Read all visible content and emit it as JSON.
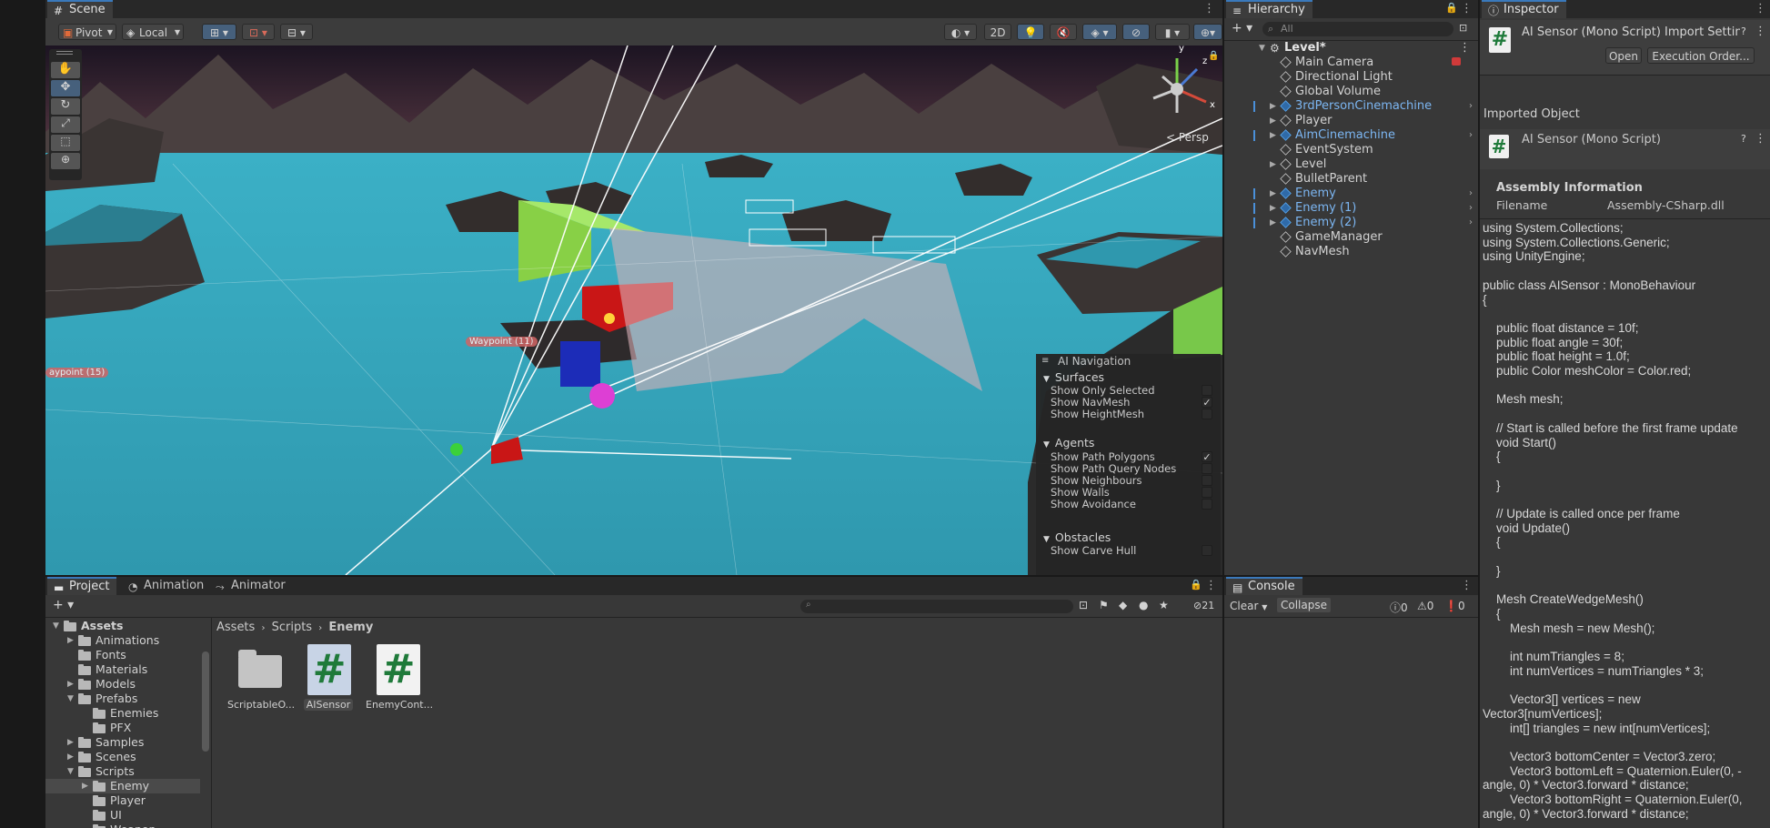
{
  "scene": {
    "tab_label": "Scene",
    "toolbar": {
      "pivot_label": "Pivot",
      "local_label": "Local",
      "mode_2d_label": "2D"
    },
    "gizmo": {
      "persp_label": "< Persp",
      "x": "x",
      "y": "y",
      "z": "z"
    },
    "labels": {
      "waypoint_left": "aypoint (15)",
      "waypoint_center": "Waypoint (11)"
    },
    "ai_navigation": {
      "title": "AI Navigation",
      "surfaces": {
        "header": "Surfaces",
        "items": [
          {
            "label": "Show Only Selected",
            "checked": false
          },
          {
            "label": "Show NavMesh",
            "checked": true
          },
          {
            "label": "Show HeightMesh",
            "checked": false
          }
        ]
      },
      "agents": {
        "header": "Agents",
        "items": [
          {
            "label": "Show Path Polygons",
            "checked": true
          },
          {
            "label": "Show Path Query Nodes",
            "checked": false
          },
          {
            "label": "Show Neighbours",
            "checked": false
          },
          {
            "label": "Show Walls",
            "checked": false
          },
          {
            "label": "Show Avoidance",
            "checked": false
          }
        ]
      },
      "obstacles": {
        "header": "Obstacles",
        "items": [
          {
            "label": "Show Carve Hull",
            "checked": false
          }
        ]
      }
    },
    "colors": {
      "water": "#3fa8bf",
      "green_block": "#8bd44a",
      "red_block": "#d01818",
      "sky": "#3d2b3b"
    }
  },
  "hierarchy": {
    "tab_label": "Hierarchy",
    "search_placeholder": "All",
    "root": "Level*",
    "items": [
      {
        "label": "Main Camera",
        "prefab": false,
        "expandable": false
      },
      {
        "label": "Directional Light",
        "prefab": false,
        "expandable": false
      },
      {
        "label": "Global Volume",
        "prefab": false,
        "expandable": false
      },
      {
        "label": "3rdPersonCinemachine",
        "prefab": true,
        "expandable": true
      },
      {
        "label": "Player",
        "prefab": false,
        "expandable": true
      },
      {
        "label": "AimCinemachine",
        "prefab": true,
        "expandable": true
      },
      {
        "label": "EventSystem",
        "prefab": false,
        "expandable": false
      },
      {
        "label": "Level",
        "prefab": false,
        "expandable": true
      },
      {
        "label": "BulletParent",
        "prefab": false,
        "expandable": false
      },
      {
        "label": "Enemy",
        "prefab": true,
        "expandable": true
      },
      {
        "label": "Enemy (1)",
        "prefab": true,
        "expandable": true
      },
      {
        "label": "Enemy (2)",
        "prefab": true,
        "expandable": true
      },
      {
        "label": "GameManager",
        "prefab": false,
        "expandable": false
      },
      {
        "label": "NavMesh",
        "prefab": false,
        "expandable": false
      }
    ]
  },
  "inspector": {
    "tab_label": "Inspector",
    "title": "AI Sensor (Mono Script) Import Settin",
    "open_label": "Open",
    "execution_order_label": "Execution Order...",
    "imported_object_label": "Imported Object",
    "object_name": "AI Sensor (Mono Script)",
    "assembly_header": "Assembly Information",
    "filename_label": "Filename",
    "filename_value": "Assembly-CSharp.dll",
    "code_lines": [
      "using System.Collections;",
      "using System.Collections.Generic;",
      "using UnityEngine;",
      "",
      "public class AISensor : MonoBehaviour",
      "{",
      "",
      "    public float distance = 10f;",
      "    public float angle = 30f;",
      "    public float height = 1.0f;",
      "    public Color meshColor = Color.red;",
      "",
      "    Mesh mesh;",
      "",
      "    // Start is called before the first frame update",
      "    void Start()",
      "    {",
      "",
      "    }",
      "",
      "    // Update is called once per frame",
      "    void Update()",
      "    {",
      "",
      "    }",
      "",
      "    Mesh CreateWedgeMesh()",
      "    {",
      "        Mesh mesh = new Mesh();",
      "",
      "        int numTriangles = 8;",
      "        int numVertices = numTriangles * 3;",
      "",
      "        Vector3[] vertices = new",
      "Vector3[numVertices];",
      "        int[] triangles = new int[numVertices];",
      "",
      "        Vector3 bottomCenter = Vector3.zero;",
      "        Vector3 bottomLeft = Quaternion.Euler(0, -",
      "angle, 0) * Vector3.forward * distance;",
      "        Vector3 bottomRight = Quaternion.Euler(0,",
      "angle, 0) * Vector3.forward * distance;"
    ]
  },
  "project": {
    "tabs": [
      {
        "label": "Project",
        "icon": "folder-icon"
      },
      {
        "label": "Animation",
        "icon": "clock-icon"
      },
      {
        "label": "Animator",
        "icon": "animator-icon"
      }
    ],
    "hidden_count": "21",
    "breadcrumb": [
      "Assets",
      "Scripts",
      "Enemy"
    ],
    "tree": [
      {
        "label": "Assets",
        "depth": 0,
        "expanded": true,
        "bold": true
      },
      {
        "label": "Animations",
        "depth": 1,
        "expanded": false
      },
      {
        "label": "Fonts",
        "depth": 1,
        "leaf": true
      },
      {
        "label": "Materials",
        "depth": 1,
        "leaf": true
      },
      {
        "label": "Models",
        "depth": 1,
        "expanded": false
      },
      {
        "label": "Prefabs",
        "depth": 1,
        "expanded": true
      },
      {
        "label": "Enemies",
        "depth": 2,
        "leaf": true
      },
      {
        "label": "PFX",
        "depth": 2,
        "leaf": true
      },
      {
        "label": "Samples",
        "depth": 1,
        "expanded": false
      },
      {
        "label": "Scenes",
        "depth": 1,
        "expanded": false
      },
      {
        "label": "Scripts",
        "depth": 1,
        "expanded": true
      },
      {
        "label": "Enemy",
        "depth": 2,
        "expanded": false,
        "selected": true
      },
      {
        "label": "Player",
        "depth": 2,
        "leaf": true
      },
      {
        "label": "UI",
        "depth": 2,
        "leaf": true
      },
      {
        "label": "Weapon",
        "depth": 2,
        "leaf": true
      }
    ],
    "assets": [
      {
        "label": "ScriptableO...",
        "type": "folder"
      },
      {
        "label": "AISensor",
        "type": "script",
        "selected": true
      },
      {
        "label": "EnemyCont...",
        "type": "script"
      }
    ]
  },
  "console": {
    "tab_label": "Console",
    "clear_label": "Clear",
    "collapse_label": "Collapse",
    "info_count": "0",
    "warning_count": "0",
    "error_count": "0"
  }
}
